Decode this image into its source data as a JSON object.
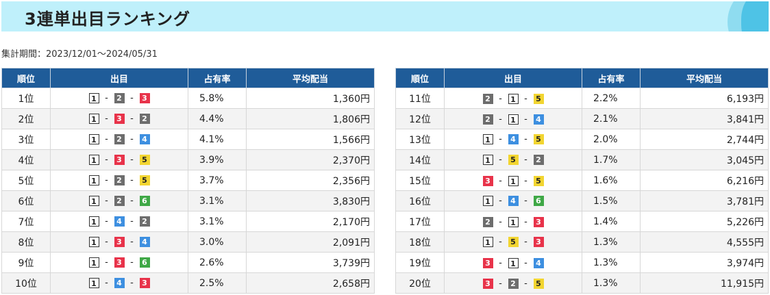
{
  "header": {
    "title": "3連単出目ランキング"
  },
  "period": {
    "text": "集計期間：2023/12/01〜2024/05/31"
  },
  "columns": {
    "rank": "順位",
    "combo": "出目",
    "share": "占有率",
    "payout": "平均配当"
  },
  "separator": "-",
  "colors": {
    "header_bg": "#1f5c99",
    "banner_bg": "#bff0fb",
    "boat1": "#ffffff",
    "boat2": "#6d6d6d",
    "boat3": "#e8334a",
    "boat4": "#3d8fe0",
    "boat5": "#f2d531",
    "boat6": "#3fa846"
  },
  "left_rows": [
    {
      "rank": "1位",
      "combo": [
        "1",
        "2",
        "3"
      ],
      "share": "5.8%",
      "payout": "1,360円"
    },
    {
      "rank": "2位",
      "combo": [
        "1",
        "3",
        "2"
      ],
      "share": "4.4%",
      "payout": "1,806円"
    },
    {
      "rank": "3位",
      "combo": [
        "1",
        "2",
        "4"
      ],
      "share": "4.1%",
      "payout": "1,566円"
    },
    {
      "rank": "4位",
      "combo": [
        "1",
        "3",
        "5"
      ],
      "share": "3.9%",
      "payout": "2,370円"
    },
    {
      "rank": "5位",
      "combo": [
        "1",
        "2",
        "5"
      ],
      "share": "3.7%",
      "payout": "2,356円"
    },
    {
      "rank": "6位",
      "combo": [
        "1",
        "2",
        "6"
      ],
      "share": "3.1%",
      "payout": "3,830円"
    },
    {
      "rank": "7位",
      "combo": [
        "1",
        "4",
        "2"
      ],
      "share": "3.1%",
      "payout": "2,170円"
    },
    {
      "rank": "8位",
      "combo": [
        "1",
        "3",
        "4"
      ],
      "share": "3.0%",
      "payout": "2,091円"
    },
    {
      "rank": "9位",
      "combo": [
        "1",
        "3",
        "6"
      ],
      "share": "2.6%",
      "payout": "3,739円"
    },
    {
      "rank": "10位",
      "combo": [
        "1",
        "4",
        "3"
      ],
      "share": "2.5%",
      "payout": "2,658円"
    }
  ],
  "right_rows": [
    {
      "rank": "11位",
      "combo": [
        "2",
        "1",
        "5"
      ],
      "share": "2.2%",
      "payout": "6,193円"
    },
    {
      "rank": "12位",
      "combo": [
        "2",
        "1",
        "4"
      ],
      "share": "2.1%",
      "payout": "3,841円"
    },
    {
      "rank": "13位",
      "combo": [
        "1",
        "4",
        "5"
      ],
      "share": "2.0%",
      "payout": "2,744円"
    },
    {
      "rank": "14位",
      "combo": [
        "1",
        "5",
        "2"
      ],
      "share": "1.7%",
      "payout": "3,045円"
    },
    {
      "rank": "15位",
      "combo": [
        "3",
        "1",
        "5"
      ],
      "share": "1.6%",
      "payout": "6,216円"
    },
    {
      "rank": "16位",
      "combo": [
        "1",
        "4",
        "6"
      ],
      "share": "1.5%",
      "payout": "3,781円"
    },
    {
      "rank": "17位",
      "combo": [
        "2",
        "1",
        "3"
      ],
      "share": "1.4%",
      "payout": "5,226円"
    },
    {
      "rank": "18位",
      "combo": [
        "1",
        "5",
        "3"
      ],
      "share": "1.3%",
      "payout": "4,555円"
    },
    {
      "rank": "19位",
      "combo": [
        "3",
        "1",
        "4"
      ],
      "share": "1.3%",
      "payout": "3,974円"
    },
    {
      "rank": "20位",
      "combo": [
        "3",
        "2",
        "5"
      ],
      "share": "1.3%",
      "payout": "11,915円"
    }
  ]
}
